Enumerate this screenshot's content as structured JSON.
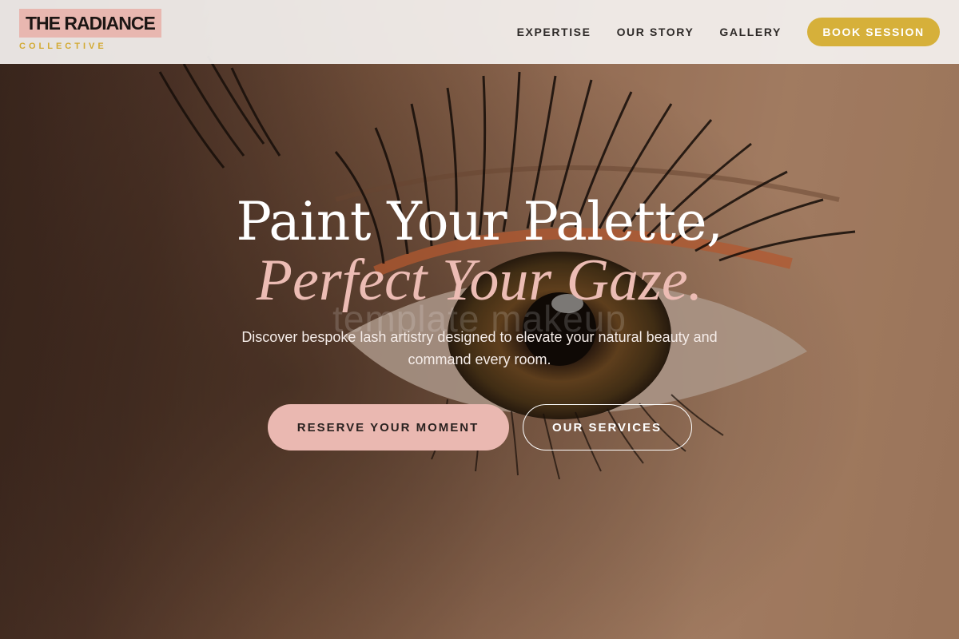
{
  "brand": {
    "name": "THE RADIANCE",
    "subtitle": "COLLECTIVE"
  },
  "nav": {
    "links": [
      {
        "label": "EXPERTISE"
      },
      {
        "label": "OUR STORY"
      },
      {
        "label": "GALLERY"
      }
    ],
    "cta_label": "BOOK SESSION"
  },
  "hero": {
    "headline_line1": "Paint Your Palette,",
    "headline_line2": "Perfect Your Gaze.",
    "watermark": "template makeup",
    "tagline": "Discover bespoke lash artistry designed to elevate your natural beauty and command every room.",
    "primary_cta": "RESERVE YOUR MOMENT",
    "secondary_cta": "OUR SERVICES"
  },
  "colors": {
    "accent_gold": "#d6b03a",
    "accent_pink": "#eab8b1",
    "logo_bg": "#e8b7b0",
    "header_bg": "#f4f1ef"
  },
  "icons": {
    "hero_image": "eye-closeup-photo"
  }
}
